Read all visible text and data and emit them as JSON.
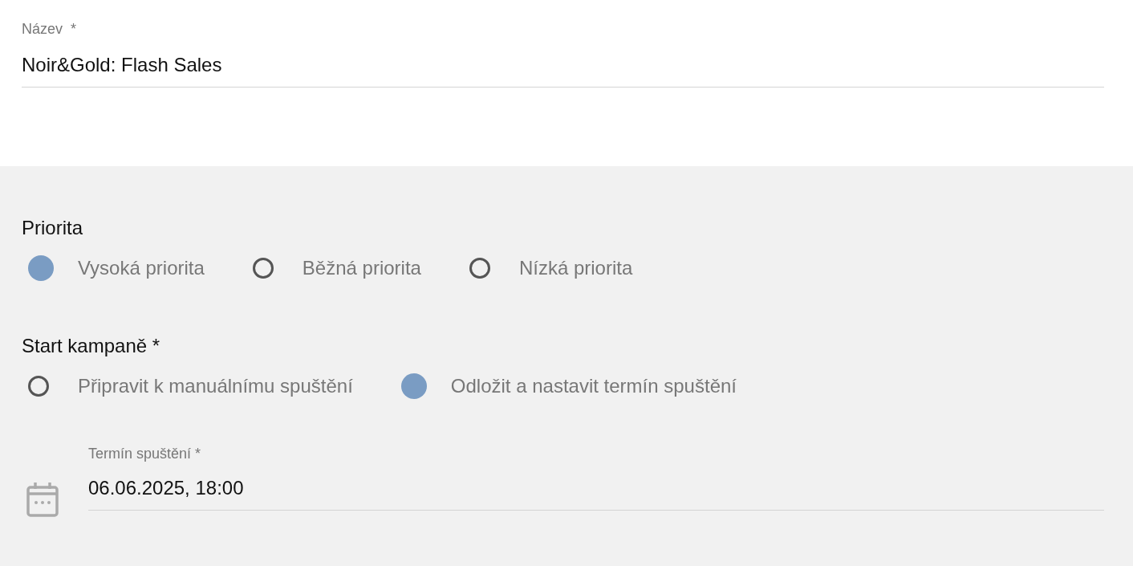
{
  "name_field": {
    "label": "Název",
    "required_mark": "*",
    "value": "Noir&Gold: Flash Sales"
  },
  "priority": {
    "label": "Priorita",
    "options": [
      {
        "label": "Vysoká priorita",
        "selected": true
      },
      {
        "label": "Běžná priorita",
        "selected": false
      },
      {
        "label": "Nízká priorita",
        "selected": false
      }
    ]
  },
  "campaign_start": {
    "label": "Start kampaně *",
    "options": [
      {
        "label": "Připravit k manuálnímu spuštění",
        "selected": false
      },
      {
        "label": "Odložit a nastavit termín spuštění",
        "selected": true
      }
    ]
  },
  "start_date": {
    "label": "Termín spuštění *",
    "value": "06.06.2025, 18:00"
  }
}
